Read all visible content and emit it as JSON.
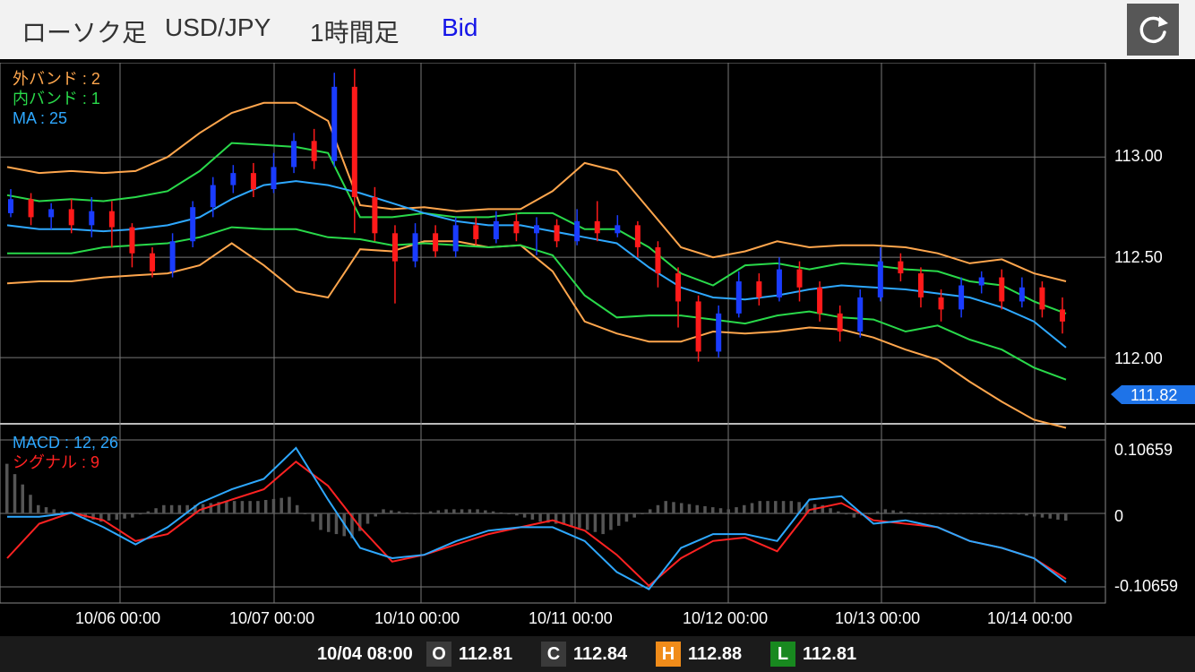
{
  "header": {
    "chart_type": "ローソク足",
    "pair": "USD/JPY",
    "timeframe": "1時間足",
    "price_type": "Bid",
    "refresh_icon": "refresh-icon"
  },
  "legend": {
    "outer_band": "外バンド : 2",
    "inner_band": "内バンド : 1",
    "ma": "MA : 25",
    "macd": "MACD : 12, 26",
    "signal": "シグナル : 9"
  },
  "price_axis": {
    "labels": [
      "113.00",
      "112.50",
      "112.00"
    ],
    "current": "111.82"
  },
  "macd_axis": {
    "labels": [
      "0.10659",
      "0",
      "-0.10659"
    ]
  },
  "time_axis": {
    "labels": [
      "10/06 00:00",
      "10/07 00:00",
      "10/10 00:00",
      "10/11 00:00",
      "10/12 00:00",
      "10/13 00:00",
      "10/14 00:00"
    ]
  },
  "footer": {
    "datetime": "10/04 08:00",
    "o_label": "O",
    "open": "112.81",
    "c_label": "C",
    "close": "112.84",
    "h_label": "H",
    "high": "112.88",
    "l_label": "L",
    "low": "112.81"
  },
  "colors": {
    "up": "#1a3cff",
    "down": "#ff1a1a",
    "outer_band": "#ffa64d",
    "inner_band": "#29d94a",
    "ma": "#2ea8ff",
    "macd": "#2ea8ff",
    "signal": "#ff2222",
    "histogram": "#555555",
    "current_tag": "#1e73e8"
  },
  "chart_data": {
    "type": "candlestick",
    "price_range": [
      111.67,
      113.47
    ],
    "macd_range": [
      -0.13,
      0.13
    ],
    "x": [
      "10/06 00:00",
      "10/07 00:00",
      "10/10 00:00",
      "10/11 00:00",
      "10/12 00:00",
      "10/13 00:00",
      "10/14 00:00"
    ],
    "ma": [
      112.66,
      112.64,
      112.64,
      112.63,
      112.64,
      112.66,
      112.7,
      112.79,
      112.86,
      112.88,
      112.86,
      112.82,
      112.77,
      112.72,
      112.68,
      112.66,
      112.66,
      112.63,
      112.6,
      112.57,
      112.45,
      112.35,
      112.3,
      112.29,
      112.31,
      112.34,
      112.36,
      112.35,
      112.34,
      112.32,
      112.3,
      112.25,
      112.18,
      112.05
    ],
    "inner_band": [
      112.81,
      112.78,
      112.79,
      112.78,
      112.8,
      112.83,
      112.93,
      113.07,
      113.06,
      113.05,
      113.02,
      112.7,
      112.7,
      112.72,
      112.7,
      112.7,
      112.72,
      112.72,
      112.64,
      112.64,
      112.55,
      112.42,
      112.36,
      112.46,
      112.47,
      112.44,
      112.47,
      112.46,
      112.44,
      112.43,
      112.38,
      112.36,
      112.28,
      112.22
    ],
    "lower_inner": [
      112.52,
      112.52,
      112.52,
      112.55,
      112.56,
      112.57,
      112.6,
      112.65,
      112.64,
      112.64,
      112.6,
      112.59,
      112.56,
      112.57,
      112.56,
      112.55,
      112.56,
      112.51,
      112.31,
      112.2,
      112.21,
      112.21,
      112.19,
      112.17,
      112.21,
      112.23,
      112.2,
      112.19,
      112.13,
      112.16,
      112.09,
      112.04,
      111.95,
      111.89
    ],
    "outer_band": [
      112.95,
      112.92,
      112.93,
      112.92,
      112.93,
      113.0,
      113.12,
      113.22,
      113.27,
      113.27,
      113.18,
      112.76,
      112.74,
      112.75,
      112.73,
      112.74,
      112.74,
      112.83,
      112.97,
      112.93,
      112.74,
      112.55,
      112.5,
      112.53,
      112.58,
      112.55,
      112.56,
      112.56,
      112.55,
      112.52,
      112.47,
      112.49,
      112.42,
      112.38
    ],
    "lower_outer": [
      112.37,
      112.38,
      112.38,
      112.4,
      112.41,
      112.42,
      112.46,
      112.57,
      112.46,
      112.33,
      112.3,
      112.54,
      112.53,
      112.58,
      112.58,
      112.55,
      112.56,
      112.43,
      112.18,
      112.12,
      112.08,
      112.08,
      112.13,
      112.12,
      112.13,
      112.15,
      112.14,
      112.1,
      112.04,
      111.99,
      111.88,
      111.78,
      111.69,
      111.65
    ],
    "macd_values": [
      -0.005,
      -0.005,
      0.001,
      -0.02,
      -0.045,
      -0.02,
      0.015,
      0.035,
      0.05,
      0.095,
      0.02,
      -0.05,
      -0.065,
      -0.06,
      -0.04,
      -0.025,
      -0.02,
      -0.02,
      -0.04,
      -0.085,
      -0.11,
      -0.05,
      -0.03,
      -0.03,
      -0.04,
      0.02,
      0.025,
      -0.015,
      -0.01,
      -0.02,
      -0.04,
      -0.05,
      -0.065,
      -0.1
    ],
    "signal_values": [
      -0.065,
      -0.015,
      0.001,
      -0.01,
      -0.04,
      -0.03,
      0.005,
      0.02,
      0.035,
      0.075,
      0.04,
      -0.02,
      -0.07,
      -0.06,
      -0.045,
      -0.03,
      -0.02,
      -0.01,
      -0.025,
      -0.06,
      -0.105,
      -0.065,
      -0.04,
      -0.035,
      -0.055,
      0.005,
      0.015,
      -0.01,
      -0.015,
      -0.02,
      -0.04,
      -0.05,
      -0.065,
      -0.095
    ],
    "candles": [
      {
        "o": 112.72,
        "c": 112.79,
        "h": 112.84,
        "l": 112.7
      },
      {
        "o": 112.79,
        "c": 112.7,
        "h": 112.82,
        "l": 112.66
      },
      {
        "o": 112.7,
        "c": 112.74,
        "h": 112.77,
        "l": 112.64
      },
      {
        "o": 112.74,
        "c": 112.66,
        "h": 112.79,
        "l": 112.62
      },
      {
        "o": 112.66,
        "c": 112.73,
        "h": 112.8,
        "l": 112.6
      },
      {
        "o": 112.73,
        "c": 112.65,
        "h": 112.78,
        "l": 112.55
      },
      {
        "o": 112.65,
        "c": 112.52,
        "h": 112.67,
        "l": 112.45
      },
      {
        "o": 112.52,
        "c": 112.43,
        "h": 112.55,
        "l": 112.4
      },
      {
        "o": 112.43,
        "c": 112.58,
        "h": 112.62,
        "l": 112.4
      },
      {
        "o": 112.58,
        "c": 112.75,
        "h": 112.78,
        "l": 112.55
      },
      {
        "o": 112.75,
        "c": 112.86,
        "h": 112.9,
        "l": 112.7
      },
      {
        "o": 112.86,
        "c": 112.92,
        "h": 112.96,
        "l": 112.82
      },
      {
        "o": 112.92,
        "c": 112.84,
        "h": 112.97,
        "l": 112.8
      },
      {
        "o": 112.84,
        "c": 112.95,
        "h": 113.02,
        "l": 112.82
      },
      {
        "o": 112.95,
        "c": 113.08,
        "h": 113.12,
        "l": 112.92
      },
      {
        "o": 113.08,
        "c": 112.98,
        "h": 113.14,
        "l": 112.94
      },
      {
        "o": 112.98,
        "c": 113.35,
        "h": 113.42,
        "l": 112.95
      },
      {
        "o": 113.35,
        "c": 112.8,
        "h": 113.44,
        "l": 112.62
      },
      {
        "o": 112.8,
        "c": 112.62,
        "h": 112.85,
        "l": 112.58
      },
      {
        "o": 112.62,
        "c": 112.48,
        "h": 112.66,
        "l": 112.27
      },
      {
        "o": 112.48,
        "c": 112.62,
        "h": 112.67,
        "l": 112.45
      },
      {
        "o": 112.62,
        "c": 112.53,
        "h": 112.66,
        "l": 112.5
      },
      {
        "o": 112.53,
        "c": 112.66,
        "h": 112.7,
        "l": 112.5
      },
      {
        "o": 112.66,
        "c": 112.59,
        "h": 112.7,
        "l": 112.56
      },
      {
        "o": 112.59,
        "c": 112.68,
        "h": 112.73,
        "l": 112.57
      },
      {
        "o": 112.68,
        "c": 112.62,
        "h": 112.72,
        "l": 112.58
      },
      {
        "o": 112.62,
        "c": 112.66,
        "h": 112.7,
        "l": 112.51
      },
      {
        "o": 112.66,
        "c": 112.58,
        "h": 112.69,
        "l": 112.55
      },
      {
        "o": 112.58,
        "c": 112.68,
        "h": 112.74,
        "l": 112.56
      },
      {
        "o": 112.68,
        "c": 112.62,
        "h": 112.78,
        "l": 112.58
      },
      {
        "o": 112.62,
        "c": 112.66,
        "h": 112.71,
        "l": 112.6
      },
      {
        "o": 112.66,
        "c": 112.55,
        "h": 112.68,
        "l": 112.5
      },
      {
        "o": 112.55,
        "c": 112.42,
        "h": 112.58,
        "l": 112.35
      },
      {
        "o": 112.42,
        "c": 112.28,
        "h": 112.45,
        "l": 112.15
      },
      {
        "o": 112.28,
        "c": 112.03,
        "h": 112.31,
        "l": 111.98
      },
      {
        "o": 112.03,
        "c": 112.22,
        "h": 112.26,
        "l": 112.0
      },
      {
        "o": 112.22,
        "c": 112.38,
        "h": 112.43,
        "l": 112.2
      },
      {
        "o": 112.38,
        "c": 112.3,
        "h": 112.42,
        "l": 112.26
      },
      {
        "o": 112.3,
        "c": 112.44,
        "h": 112.5,
        "l": 112.28
      },
      {
        "o": 112.44,
        "c": 112.35,
        "h": 112.48,
        "l": 112.28
      },
      {
        "o": 112.35,
        "c": 112.22,
        "h": 112.38,
        "l": 112.18
      },
      {
        "o": 112.22,
        "c": 112.13,
        "h": 112.26,
        "l": 112.08
      },
      {
        "o": 112.13,
        "c": 112.3,
        "h": 112.34,
        "l": 112.1
      },
      {
        "o": 112.3,
        "c": 112.48,
        "h": 112.55,
        "l": 112.28
      },
      {
        "o": 112.48,
        "c": 112.42,
        "h": 112.52,
        "l": 112.38
      },
      {
        "o": 112.42,
        "c": 112.3,
        "h": 112.45,
        "l": 112.25
      },
      {
        "o": 112.3,
        "c": 112.24,
        "h": 112.34,
        "l": 112.18
      },
      {
        "o": 112.24,
        "c": 112.36,
        "h": 112.4,
        "l": 112.2
      },
      {
        "o": 112.36,
        "c": 112.4,
        "h": 112.43,
        "l": 112.32
      },
      {
        "o": 112.4,
        "c": 112.28,
        "h": 112.44,
        "l": 112.24
      },
      {
        "o": 112.28,
        "c": 112.35,
        "h": 112.4,
        "l": 112.25
      },
      {
        "o": 112.35,
        "c": 112.24,
        "h": 112.38,
        "l": 112.2
      },
      {
        "o": 112.24,
        "c": 112.18,
        "h": 112.3,
        "l": 112.12
      }
    ]
  }
}
